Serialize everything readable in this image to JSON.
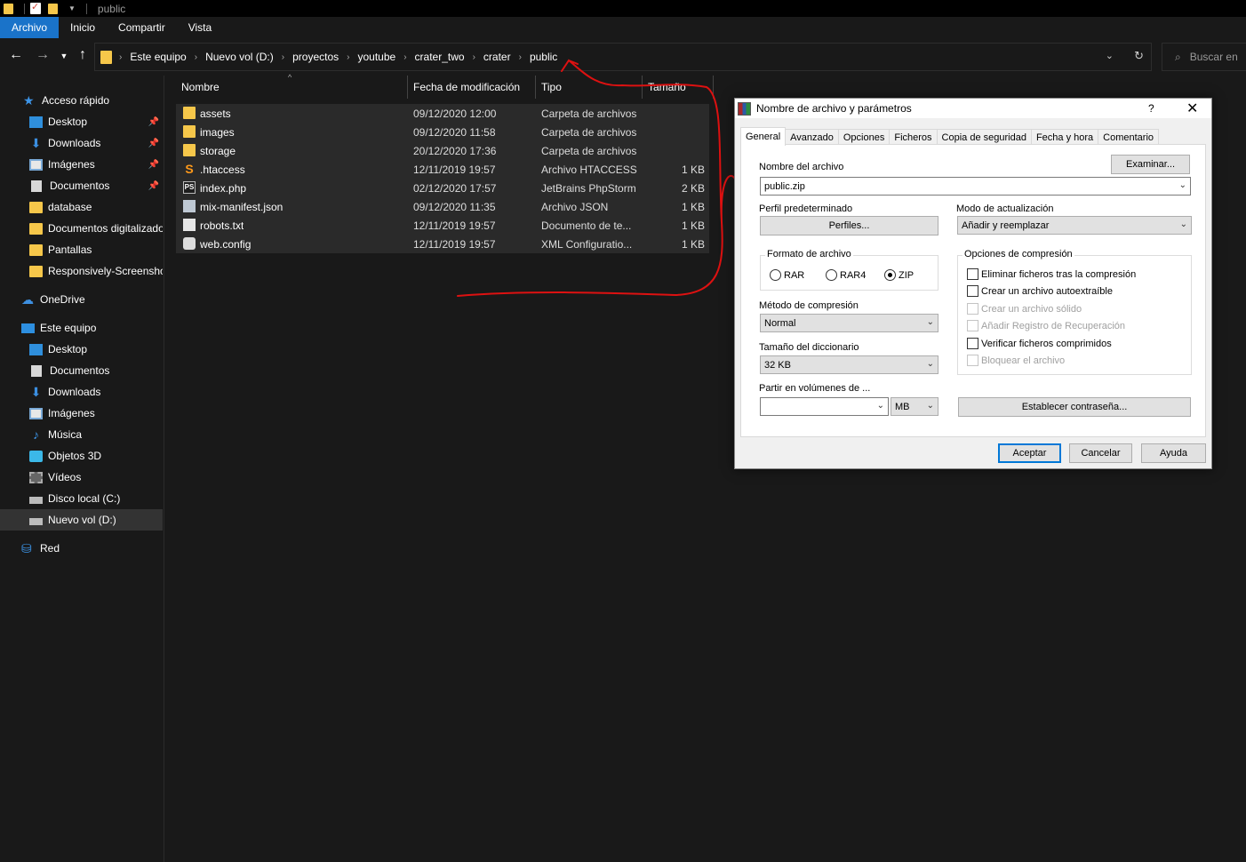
{
  "window": {
    "title": "public"
  },
  "ribbon": {
    "tabs": [
      "Archivo",
      "Inicio",
      "Compartir",
      "Vista"
    ]
  },
  "address": {
    "crumbs": [
      "Este equipo",
      "Nuevo vol (D:)",
      "proyectos",
      "youtube",
      "crater_two",
      "crater",
      "public"
    ],
    "search_placeholder": "Buscar en"
  },
  "nav": {
    "items": [
      {
        "label": "Acceso rápido",
        "icon": "star-icon"
      },
      {
        "label": "Desktop",
        "icon": "desktop-icon"
      },
      {
        "label": "Downloads",
        "icon": "download-icon"
      },
      {
        "label": "Imágenes",
        "icon": "pictures-icon"
      },
      {
        "label": "Documentos",
        "icon": "document-icon"
      },
      {
        "label": "database",
        "icon": "folder-icon"
      },
      {
        "label": "Documentos digitalizados",
        "icon": "folder-icon"
      },
      {
        "label": "Pantallas",
        "icon": "folder-icon"
      },
      {
        "label": "Responsively-Screenshots",
        "icon": "folder-icon"
      },
      {
        "label": "OneDrive",
        "icon": "cloud-icon"
      },
      {
        "label": "Este equipo",
        "icon": "computer-icon"
      },
      {
        "label": "Desktop",
        "icon": "desktop-icon"
      },
      {
        "label": "Documentos",
        "icon": "document-icon"
      },
      {
        "label": "Downloads",
        "icon": "download-icon"
      },
      {
        "label": "Imágenes",
        "icon": "pictures-icon"
      },
      {
        "label": "Música",
        "icon": "music-icon"
      },
      {
        "label": "Objetos 3D",
        "icon": "objects-3d-icon"
      },
      {
        "label": "Vídeos",
        "icon": "video-icon"
      },
      {
        "label": "Disco local (C:)",
        "icon": "drive-icon"
      },
      {
        "label": "Nuevo vol (D:)",
        "icon": "drive-icon"
      },
      {
        "label": "Red",
        "icon": "network-icon"
      }
    ]
  },
  "files": {
    "columns": [
      "Nombre",
      "Fecha de modificación",
      "Tipo",
      "Tamaño"
    ],
    "rows": [
      {
        "name": "assets",
        "date": "09/12/2020 12:00",
        "type": "Carpeta de archivos",
        "size": "",
        "icon": "folder-icon"
      },
      {
        "name": "images",
        "date": "09/12/2020 11:58",
        "type": "Carpeta de archivos",
        "size": "",
        "icon": "folder-icon"
      },
      {
        "name": "storage",
        "date": "20/12/2020 17:36",
        "type": "Carpeta de archivos",
        "size": "",
        "icon": "folder-shortcut-icon"
      },
      {
        "name": ".htaccess",
        "date": "12/11/2019 19:57",
        "type": "Archivo HTACCESS",
        "size": "1 KB",
        "icon": "sublime-icon"
      },
      {
        "name": "index.php",
        "date": "02/12/2020 17:57",
        "type": "JetBrains PhpStorm",
        "size": "2 KB",
        "icon": "phpstorm-icon"
      },
      {
        "name": "mix-manifest.json",
        "date": "09/12/2020 11:35",
        "type": "Archivo JSON",
        "size": "1 KB",
        "icon": "json-file-icon"
      },
      {
        "name": "robots.txt",
        "date": "12/11/2019 19:57",
        "type": "Documento de te...",
        "size": "1 KB",
        "icon": "text-file-icon"
      },
      {
        "name": "web.config",
        "date": "12/11/2019 19:57",
        "type": "XML Configuratio...",
        "size": "1 KB",
        "icon": "config-file-icon"
      }
    ]
  },
  "dialog": {
    "title": "Nombre de archivo y parámetros",
    "help": "?",
    "close": "✕",
    "tabs": [
      "General",
      "Avanzado",
      "Opciones",
      "Ficheros",
      "Copia de seguridad",
      "Fecha y hora",
      "Comentario"
    ],
    "filename_label": "Nombre del archivo",
    "filename_value": "public.zip",
    "browse_label": "Examinar...",
    "profile_label": "Perfil predeterminado",
    "profiles_button": "Perfiles...",
    "update_mode_label": "Modo de actualización",
    "update_mode_value": "Añadir y reemplazar",
    "format_label": "Formato de archivo",
    "formats": [
      "RAR",
      "RAR4",
      "ZIP"
    ],
    "format_selected": "ZIP",
    "compression_method_label": "Método de compresión",
    "compression_method_value": "Normal",
    "dict_size_label": "Tamaño del diccionario",
    "dict_size_value": "32 KB",
    "split_label": "Partir en volúmenes de ...",
    "split_value": "",
    "split_unit": "MB",
    "options_label": "Opciones de compresión",
    "options": [
      {
        "label": "Eliminar ficheros tras la compresión",
        "enabled": true
      },
      {
        "label": "Crear un archivo autoextraíble",
        "enabled": true
      },
      {
        "label": "Crear un archivo sólido",
        "enabled": false
      },
      {
        "label": "Añadir Registro de Recuperación",
        "enabled": false
      },
      {
        "label": "Verificar ficheros comprimidos",
        "enabled": true
      },
      {
        "label": "Bloquear el archivo",
        "enabled": false
      }
    ],
    "password_button": "Establecer contraseña...",
    "ok_button": "Aceptar",
    "cancel_button": "Cancelar",
    "help_button": "Ayuda"
  }
}
